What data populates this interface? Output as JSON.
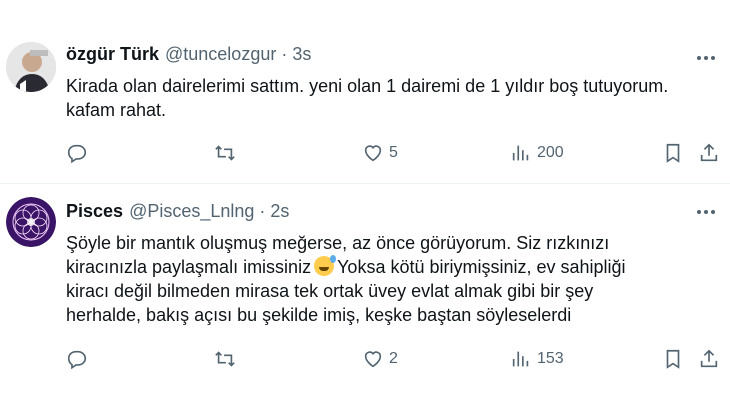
{
  "tweets": [
    {
      "name": "özgür Türk",
      "handle": "@tuncelozgur",
      "separator": "·",
      "time": "3s",
      "lines": [
        "Kirada olan dairelerimi sattım. yeni olan 1 dairemi de 1 yıldır boş tutuyorum.",
        "kafam rahat."
      ],
      "likes": "5",
      "views": "200"
    },
    {
      "name": "Pisces",
      "handle": "@Pisces_Lnlng",
      "separator": "·",
      "time": "2s",
      "lines": [
        "Şöyle bir mantık oluşmuş meğerse, az önce görüyorum. Siz rızkınızı",
        "kiracınızla paylaşmalı imissiniz",
        "Yoksa kötü biriymişsiniz, ev sahipliği",
        "kiracı değil bilmeden mirasa tek ortak üvey evlat almak gibi bir şey",
        "herhalde, bakış açısı bu şekilde imiş, keşke baştan söyleselerdi"
      ],
      "emoji": "grinning-face-with-sweat",
      "likes": "2",
      "views": "153"
    }
  ],
  "icons": [
    "reply-icon",
    "retweet-icon",
    "like-icon",
    "views-icon",
    "bookmark-icon",
    "share-icon",
    "more-icon"
  ]
}
